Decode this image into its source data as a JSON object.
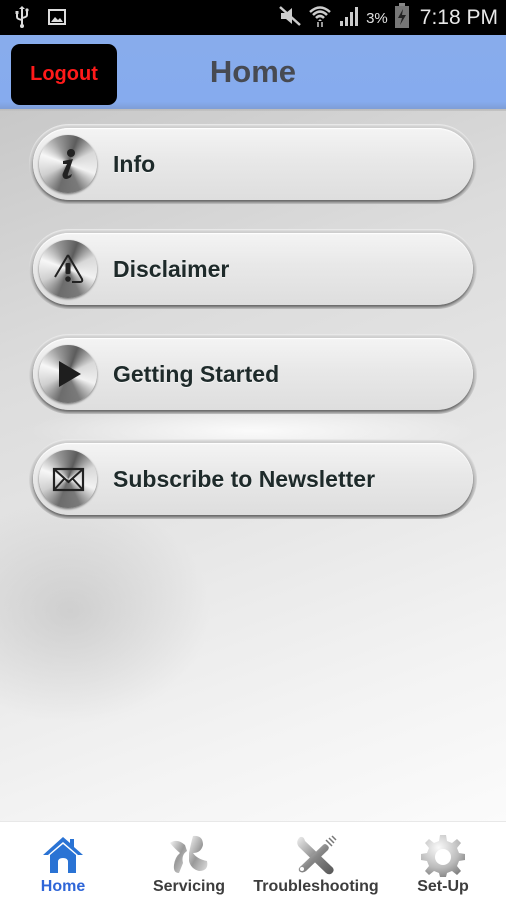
{
  "status_bar": {
    "left_icons": [
      "usb-icon",
      "image-icon"
    ],
    "right_icons": [
      "mute-icon",
      "wifi-icon",
      "signal-icon",
      "battery-charging-icon"
    ],
    "battery_percent": "3%",
    "time": "7:18 PM"
  },
  "header": {
    "logout_label": "Logout",
    "title": "Home",
    "background_color": "#88acec",
    "logout_text_color": "#ff1a1a"
  },
  "menu": {
    "items": [
      {
        "label": "Info",
        "icon": "info-icon"
      },
      {
        "label": "Disclaimer",
        "icon": "warning-icon"
      },
      {
        "label": "Getting Started",
        "icon": "play-icon"
      },
      {
        "label": "Subscribe to Newsletter",
        "icon": "envelope-icon"
      }
    ]
  },
  "tabbar": {
    "active_color": "#2f66d8",
    "tabs": [
      {
        "label": "Home",
        "icon": "home-icon",
        "active": true
      },
      {
        "label": "Servicing",
        "icon": "servicing-icon",
        "active": false
      },
      {
        "label": "Troubleshooting",
        "icon": "tools-icon",
        "active": false
      },
      {
        "label": "Set-Up",
        "icon": "gear-icon",
        "active": false
      }
    ]
  }
}
